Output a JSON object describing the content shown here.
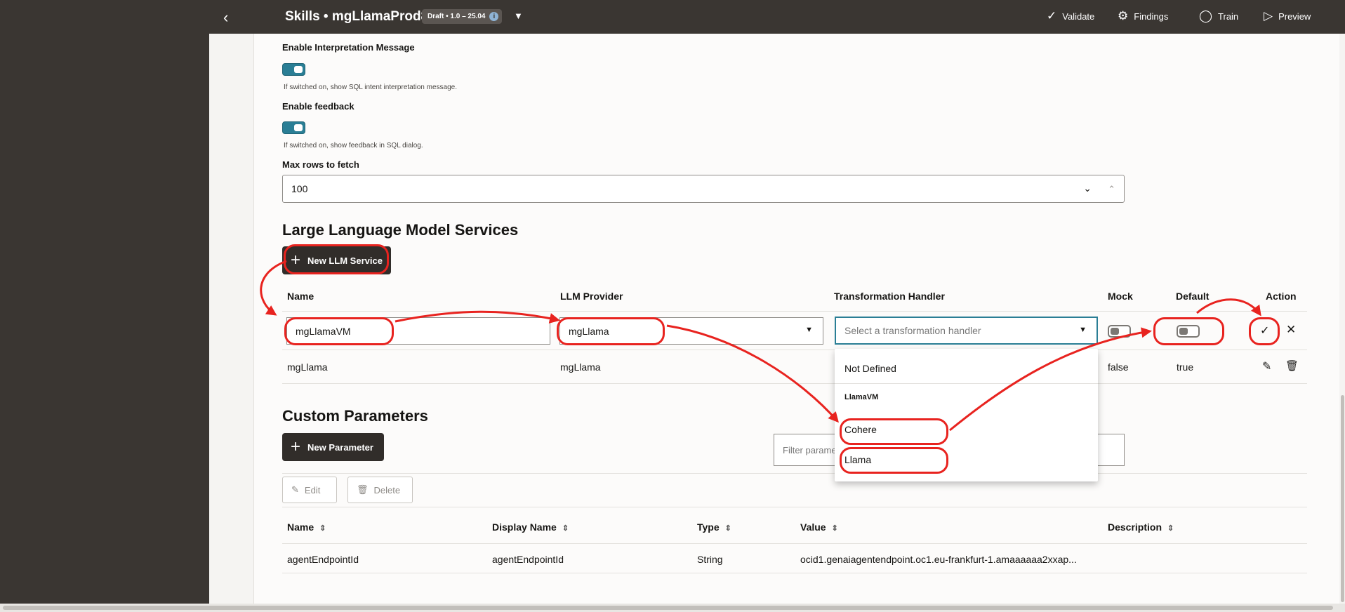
{
  "header": {
    "title": "Skills • mgLlamaProd8",
    "badge": "Draft • 1.0 – 25.04",
    "buttons": {
      "validate": "Validate",
      "findings": "Findings",
      "train": "Train",
      "preview": "Preview"
    }
  },
  "settings": {
    "interpretation": {
      "label": "Enable Interpretation Message",
      "help": "If switched on, show SQL intent interpretation message.",
      "on": true
    },
    "feedback": {
      "label": "Enable feedback",
      "help": "If switched on, show feedback in SQL dialog.",
      "on": true
    },
    "max_rows": {
      "label": "Max rows to fetch",
      "value": "100"
    }
  },
  "llm": {
    "section_title": "Large Language Model Services",
    "new_button": "New LLM Service",
    "columns": {
      "name": "Name",
      "provider": "LLM Provider",
      "handler": "Transformation Handler",
      "mock": "Mock",
      "default": "Default",
      "action": "Action"
    },
    "edit_row": {
      "name": "mgLlamaVM",
      "provider": "mgLlama",
      "handler_placeholder": "Select a transformation handler"
    },
    "rows": [
      {
        "name": "mgLlama",
        "provider": "mgLlama",
        "mock": "false",
        "default": "true"
      }
    ],
    "handler_dropdown": {
      "options": [
        "Not Defined"
      ],
      "group": "LlamaVM",
      "group_options": [
        "Cohere",
        "Llama"
      ]
    }
  },
  "custom_params": {
    "section_title": "Custom Parameters",
    "new_button": "New Parameter",
    "filter_placeholder": "Filter parameters",
    "edit_button": "Edit",
    "delete_button": "Delete",
    "columns": {
      "name": "Name",
      "display_name": "Display Name",
      "type": "Type",
      "value": "Value",
      "description": "Description"
    },
    "rows": [
      {
        "name": "agentEndpointId",
        "display_name": "agentEndpointId",
        "type": "String",
        "value": "ocid1.genaiagentendpoint.oc1.eu-frankfurt-1.amaaaaaa2xxap..."
      }
    ]
  },
  "colors": {
    "header_bg": "#3a3632",
    "toggle_on": "#2a7e95",
    "annotation_red": "#e8231f"
  }
}
